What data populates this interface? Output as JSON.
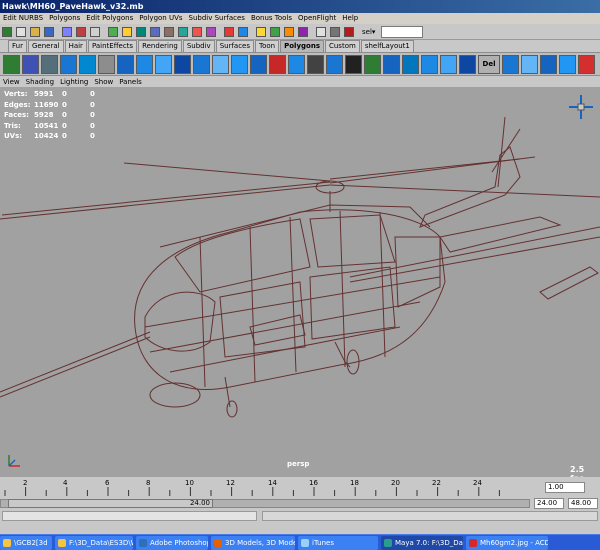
{
  "window": {
    "title": "Hawk\\MH60_PaveHawk_v32.mb"
  },
  "menus": [
    "Edit NURBS",
    "Polygons",
    "Edit Polygons",
    "Polygon UVs",
    "Subdiv Surfaces",
    "Bonus Tools",
    "OpenFlight",
    "Help"
  ],
  "statusline": {
    "selection_label": "sel▾",
    "input_value": ""
  },
  "shelf_tabs": [
    "Fur",
    "General",
    "Hair",
    "PaintEffects",
    "Rendering",
    "Subdiv",
    "Surfaces",
    "Toon",
    "Polygons",
    "Custom",
    "shelfLayout1"
  ],
  "shelf_active_tab": "Polygons",
  "shelf_text_buttons": {
    "del_e": "Del E"
  },
  "panel_menus": [
    "View",
    "Shading",
    "Lighting",
    "Show",
    "Panels"
  ],
  "hud": [
    {
      "label": "Verts:",
      "value": "5991",
      "a": "0",
      "b": "0"
    },
    {
      "label": "Edges:",
      "value": "11690",
      "a": "0",
      "b": "0"
    },
    {
      "label": "Faces:",
      "value": "5928",
      "a": "0",
      "b": "0"
    },
    {
      "label": "Tris:",
      "value": "10541",
      "a": "0",
      "b": "0"
    },
    {
      "label": "UVs:",
      "value": "10424",
      "a": "0",
      "b": "0"
    }
  ],
  "viewport": {
    "camera": "persp",
    "fps": "2.5 fps",
    "axis_labels": {
      "y": "Y",
      "x": "X",
      "z": "Z"
    },
    "wire_color": "#5a1e1e"
  },
  "timeline": {
    "ticks": [
      "2",
      "4",
      "6",
      "8",
      "10",
      "12",
      "14",
      "16",
      "18",
      "20",
      "22",
      "24"
    ],
    "current_frame": "1.00",
    "range_thumb_value": "24.00",
    "range_end": "24.00",
    "anim_end": "48.00"
  },
  "taskbar": [
    {
      "label": "\\GCB2[3d",
      "icon": "folder-icon"
    },
    {
      "label": "F:\\3D_Data\\ES3D\\W...",
      "icon": "folder-icon"
    },
    {
      "label": "Adobe Photoshop",
      "icon": "photoshop-icon"
    },
    {
      "label": "3D Models, 3D Modeli...",
      "icon": "firefox-icon"
    },
    {
      "label": "iTunes",
      "icon": "itunes-icon"
    },
    {
      "label": "Maya 7.0: F:\\3D_Dat...",
      "icon": "maya-icon"
    },
    {
      "label": "Mh60gm2.jpg - ACDS...",
      "icon": "acdsee-icon"
    }
  ]
}
